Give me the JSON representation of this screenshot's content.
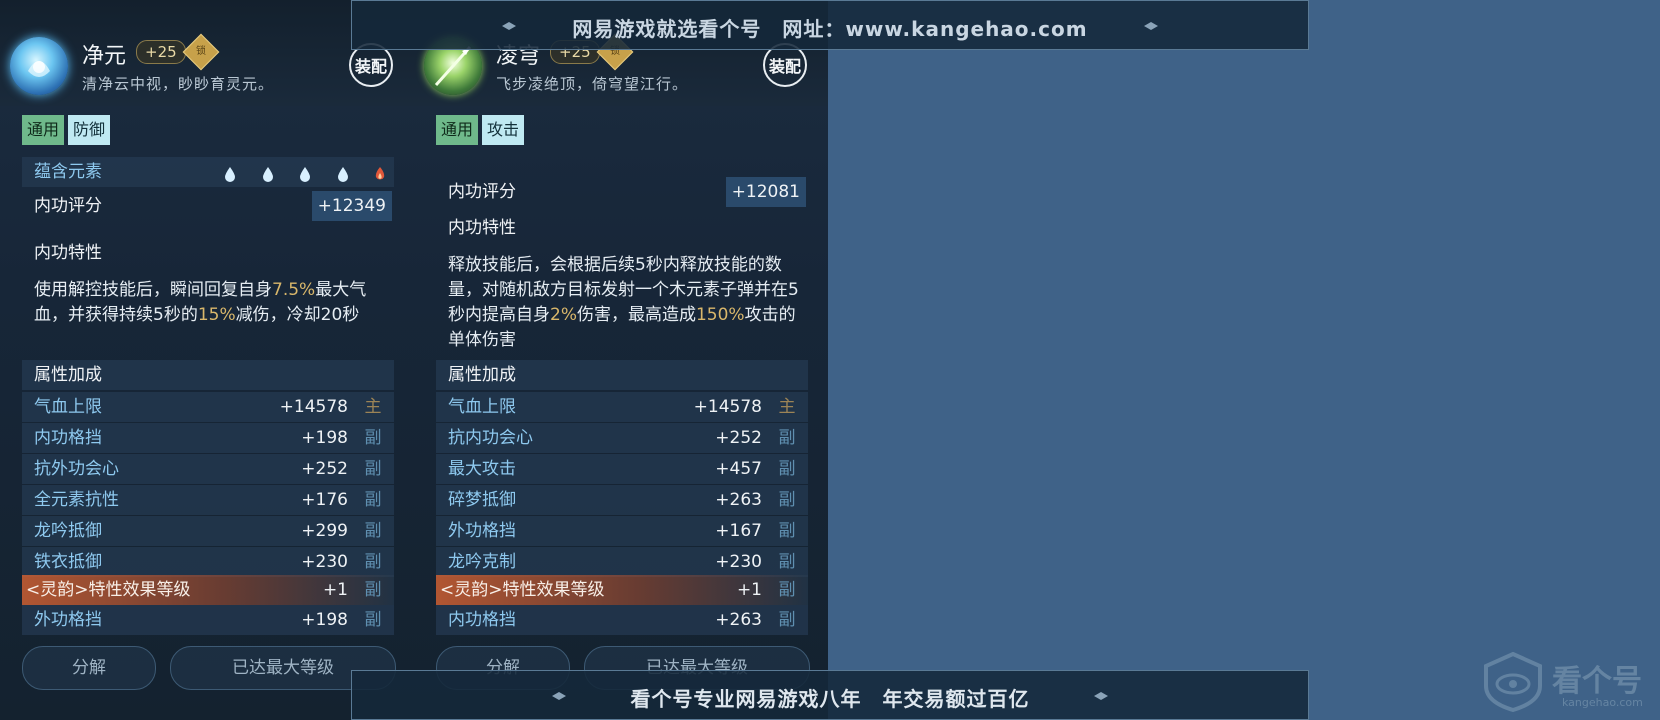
{
  "watermark": {
    "top": "网易游戏就选看个号　网址：www.kangehao.com",
    "bottom": "看个号专业网易游戏八年　年交易额过百亿",
    "logo_text": "看个号",
    "logo_sub": "kangehao.com"
  },
  "colors": {
    "accent_gold": "#d9b76b",
    "tag_common": "#6fb98b",
    "tag_type": "#bfe9f2",
    "ling_band": "#cd5f32"
  },
  "left": {
    "icon": "water-spirit-icon",
    "name": "净元",
    "plus": "+25",
    "lock": "锁",
    "motto": "清净云中视，眇眇育灵元。",
    "equip": "装配",
    "tags": [
      "通用",
      "防御"
    ],
    "element_label": "蕴含元素",
    "elements": [
      "water",
      "water",
      "water",
      "water",
      "fire"
    ],
    "score_label": "内功评分",
    "score_value": "+12349",
    "trait_label": "内功特性",
    "desc": [
      {
        "t": "使用解控技能后，瞬间回复自身",
        "h": false
      },
      {
        "t": "7.5%",
        "h": true
      },
      {
        "t": "最大气血，并获得持续5秒的",
        "h": false
      },
      {
        "t": "15%",
        "h": true
      },
      {
        "t": "减伤，冷却20秒",
        "h": false
      }
    ],
    "attr_label": "属性加成",
    "attrs": [
      {
        "name": "气血上限",
        "value": "+14578",
        "badge": "主"
      },
      {
        "name": "内功格挡",
        "value": "+198",
        "badge": "副"
      },
      {
        "name": "抗外功会心",
        "value": "+252",
        "badge": "副"
      },
      {
        "name": "全元素抗性",
        "value": "+176",
        "badge": "副"
      },
      {
        "name": "龙吟抵御",
        "value": "+299",
        "badge": "副"
      },
      {
        "name": "铁衣抵御",
        "value": "+230",
        "badge": "副"
      }
    ],
    "ling": {
      "name": "<灵韵>特性效果等级",
      "value": "+1",
      "badge": "副"
    },
    "last_attr": {
      "name": "外功格挡",
      "value": "+198",
      "badge": "副"
    },
    "btn_decompose": "分解",
    "btn_max": "已达最大等级"
  },
  "right": {
    "icon": "spear-icon",
    "name": "凌穹",
    "plus": "+25",
    "lock": "锁",
    "motto": "飞步凌绝顶，倚穹望江行。",
    "equip": "装配",
    "tags": [
      "通用",
      "攻击"
    ],
    "score_label": "内功评分",
    "score_value": "+12081",
    "trait_label": "内功特性",
    "desc": [
      {
        "t": "释放技能后，会根据后续5秒内释放技能的数量，对随机敌方目标发射一个木元素子弹并在5秒内提高自身",
        "h": false
      },
      {
        "t": "2%",
        "h": true
      },
      {
        "t": "伤害，最高造成",
        "h": false
      },
      {
        "t": "150%",
        "h": true
      },
      {
        "t": "攻击的单体伤害",
        "h": false
      }
    ],
    "attr_label": "属性加成",
    "attrs": [
      {
        "name": "气血上限",
        "value": "+14578",
        "badge": "主"
      },
      {
        "name": "抗内功会心",
        "value": "+252",
        "badge": "副"
      },
      {
        "name": "最大攻击",
        "value": "+457",
        "badge": "副"
      },
      {
        "name": "碎梦抵御",
        "value": "+263",
        "badge": "副"
      },
      {
        "name": "外功格挡",
        "value": "+167",
        "badge": "副"
      },
      {
        "name": "龙吟克制",
        "value": "+230",
        "badge": "副"
      }
    ],
    "ling": {
      "name": "<灵韵>特性效果等级",
      "value": "+1",
      "badge": "副"
    },
    "last_attr": {
      "name": "内功格挡",
      "value": "+263",
      "badge": "副"
    },
    "btn_decompose": "分解",
    "btn_max": "已达最大等级"
  }
}
